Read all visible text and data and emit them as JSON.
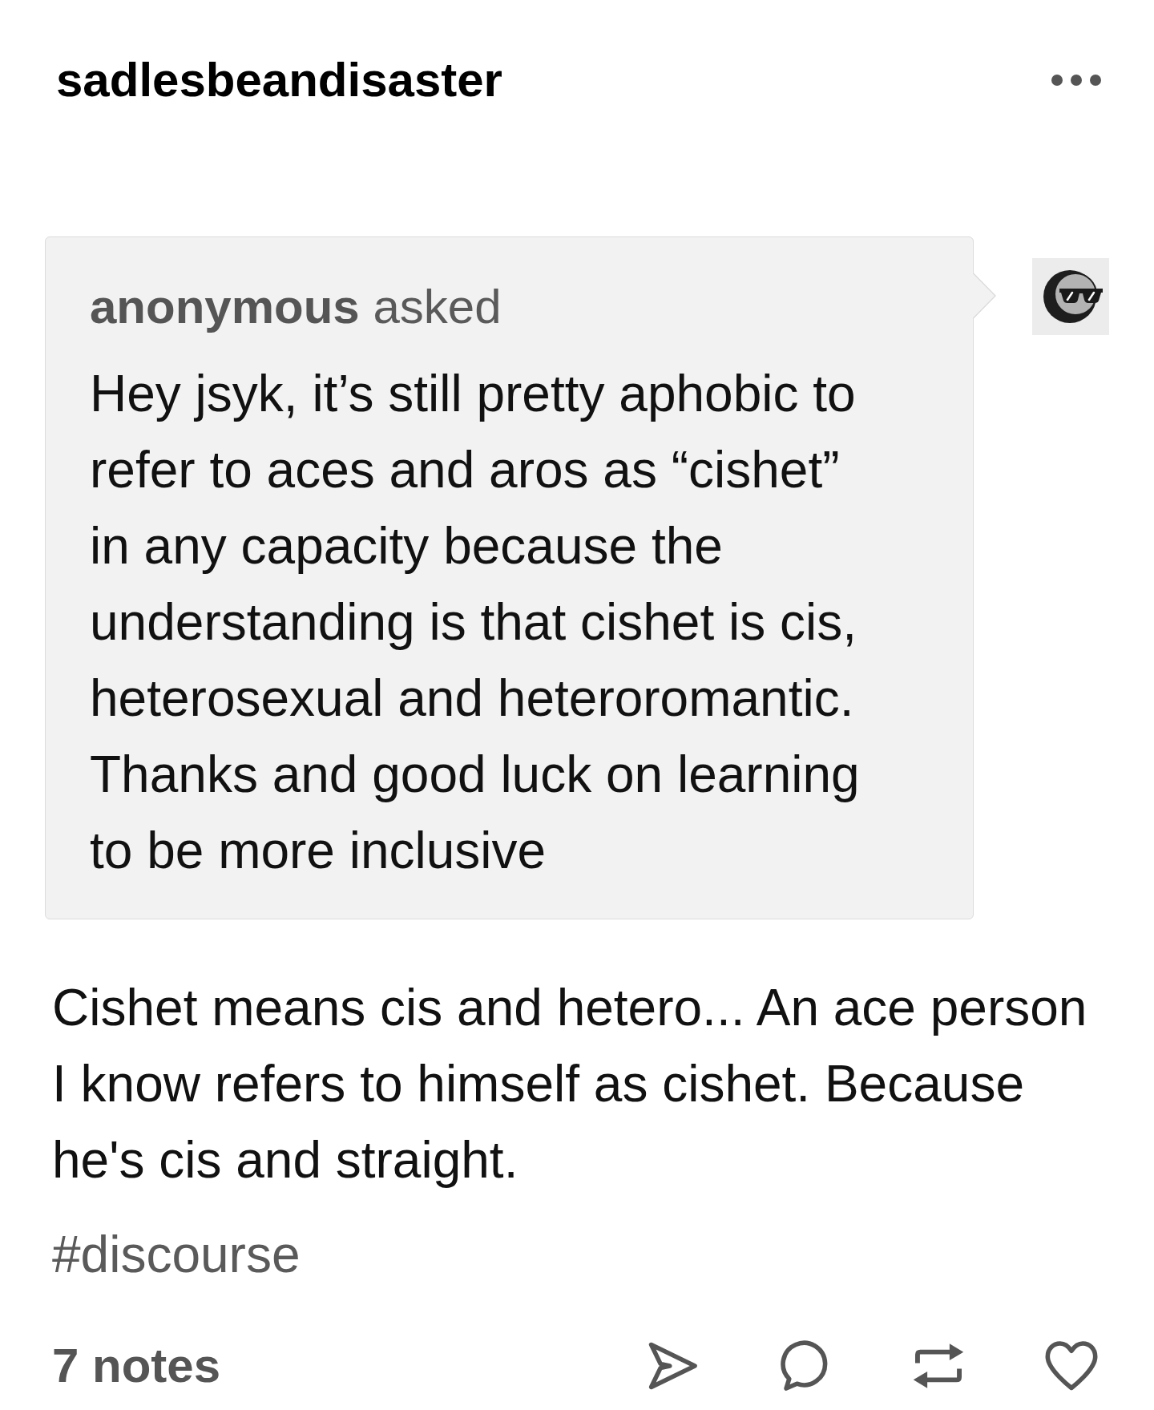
{
  "blog": {
    "name": "sadlesbeandisaster"
  },
  "ask": {
    "header": "**anonymous** asked",
    "question": "Hey jsyk, it’s still pretty aphobic to refer to aces and aros as “cishet” in any capacity because the understanding is that cishet is cis, heterosexual and heteroromantic. Thanks and good luck on learning to be more inclusive"
  },
  "answer": "Cishet means cis and hetero... An ace person I know refers to himself as cishet. Because he's cis and straight.",
  "tags": [
    "#discourse"
  ],
  "footer": {
    "notes": "7 notes"
  }
}
